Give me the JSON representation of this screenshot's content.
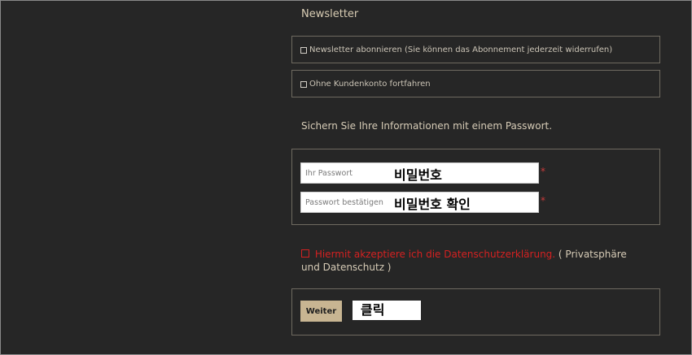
{
  "newsletter": {
    "title": "Newsletter",
    "subscribe_label": "Newsletter abonnieren (Sie können das Abonnement jederzeit widerrufen)",
    "guest_label": "Ohne Kundenkonto fortfahren"
  },
  "password_section": {
    "info": "Sichern Sie Ihre Informationen mit einem Passwort.",
    "password_placeholder": "Ihr Passwort",
    "password_annotation": "비밀번호",
    "confirm_placeholder": "Passwort bestätigen",
    "confirm_annotation": "비밀번호 확인",
    "required_mark": "*"
  },
  "consent": {
    "red_text": "Hiermit akzeptiere ich die Datenschutzerklärung.",
    "rest_text": " ( Privatsphäre und Datenschutz )"
  },
  "submit": {
    "button_label": "Weiter",
    "annotation": "클릭"
  },
  "colors": {
    "background": "#262626",
    "accent_button": "#c8b592",
    "error_red": "#d42121",
    "text": "#d6cbb6"
  }
}
